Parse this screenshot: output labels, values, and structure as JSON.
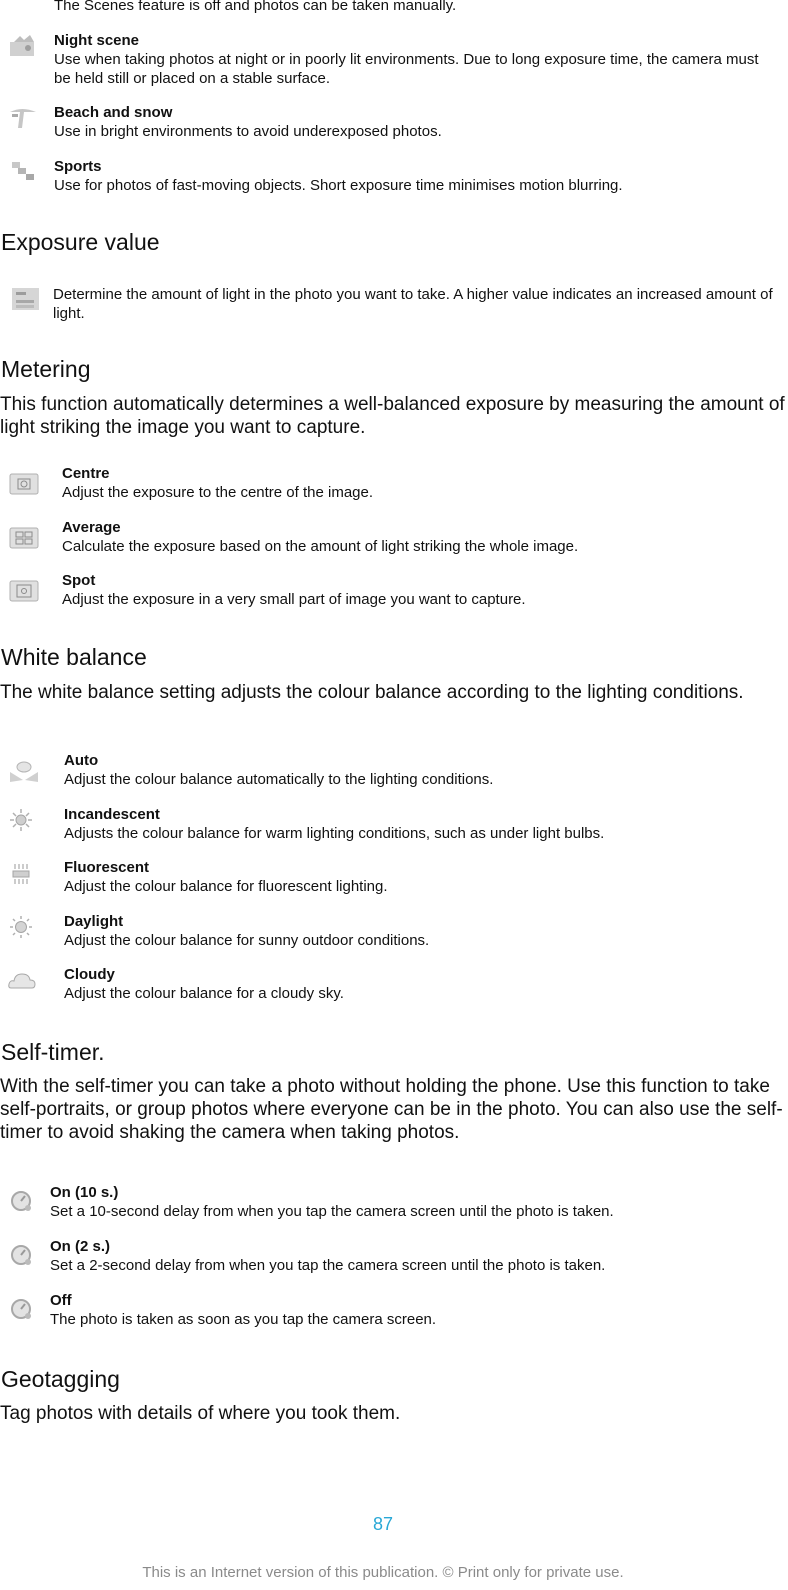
{
  "scenes": {
    "intro_tail": "The Scenes feature is off and photos can be taken manually.",
    "items": [
      {
        "icon": "night-scene-icon",
        "title": "Night scene",
        "desc": "Use when taking photos at night or in poorly lit environments. Due to long exposure time, the camera must be held still or placed on a stable surface."
      },
      {
        "icon": "beach-snow-icon",
        "title": "Beach and snow",
        "desc": "Use in bright environments to avoid underexposed photos."
      },
      {
        "icon": "sports-icon",
        "title": "Sports",
        "desc": "Use for photos of fast-moving objects. Short exposure time minimises motion blurring."
      }
    ]
  },
  "exposure": {
    "heading": "Exposure value",
    "icon": "exposure-value-icon",
    "desc": "Determine the amount of light in the photo you want to take. A higher value indicates an increased amount of light."
  },
  "metering": {
    "heading": "Metering",
    "intro": "This function automatically determines a well-balanced exposure by measuring the amount of light striking the image you want to capture.",
    "items": [
      {
        "icon": "metering-centre-icon",
        "title": "Centre",
        "desc": "Adjust the exposure to the centre of the image."
      },
      {
        "icon": "metering-average-icon",
        "title": "Average",
        "desc": "Calculate the exposure based on the amount of light striking the whole image."
      },
      {
        "icon": "metering-spot-icon",
        "title": "Spot",
        "desc": "Adjust the exposure in a very small part of image you want to capture."
      }
    ]
  },
  "white_balance": {
    "heading": "White balance",
    "intro": "The white balance setting adjusts the colour balance according to the lighting conditions.",
    "items": [
      {
        "icon": "wb-auto-icon",
        "title": "Auto",
        "desc": "Adjust the colour balance automatically to the lighting conditions."
      },
      {
        "icon": "wb-incandescent-icon",
        "title": "Incandescent",
        "desc": "Adjusts the colour balance for warm lighting conditions, such as under light bulbs."
      },
      {
        "icon": "wb-fluorescent-icon",
        "title": "Fluorescent",
        "desc": "Adjust the colour balance for fluorescent lighting."
      },
      {
        "icon": "wb-daylight-icon",
        "title": "Daylight",
        "desc": "Adjust the colour balance for sunny outdoor conditions."
      },
      {
        "icon": "wb-cloudy-icon",
        "title": "Cloudy",
        "desc": "Adjust the colour balance for a cloudy sky."
      }
    ]
  },
  "self_timer": {
    "heading": "Self-timer.",
    "intro": "With the self-timer you can take a photo without holding the phone. Use this function to take self-portraits, or group photos where everyone can be in the photo. You can also use the self-timer to avoid shaking the camera when taking photos.",
    "items": [
      {
        "icon": "self-timer-icon",
        "title": "On (10 s.)",
        "desc": "Set a 10-second delay from when you tap the camera screen until the photo is taken."
      },
      {
        "icon": "self-timer-icon",
        "title": "On (2 s.)",
        "desc": "Set a 2-second delay from when you tap the camera screen until the photo is taken."
      },
      {
        "icon": "self-timer-icon",
        "title": "Off",
        "desc": "The photo is taken as soon as you tap the camera screen."
      }
    ]
  },
  "geotagging": {
    "heading": "Geotagging",
    "intro": "Tag photos with details of where you took them."
  },
  "page": {
    "number": "87",
    "footer": "This is an Internet version of this publication. © Print only for private use.",
    "accent_color": "#29a8d6"
  }
}
